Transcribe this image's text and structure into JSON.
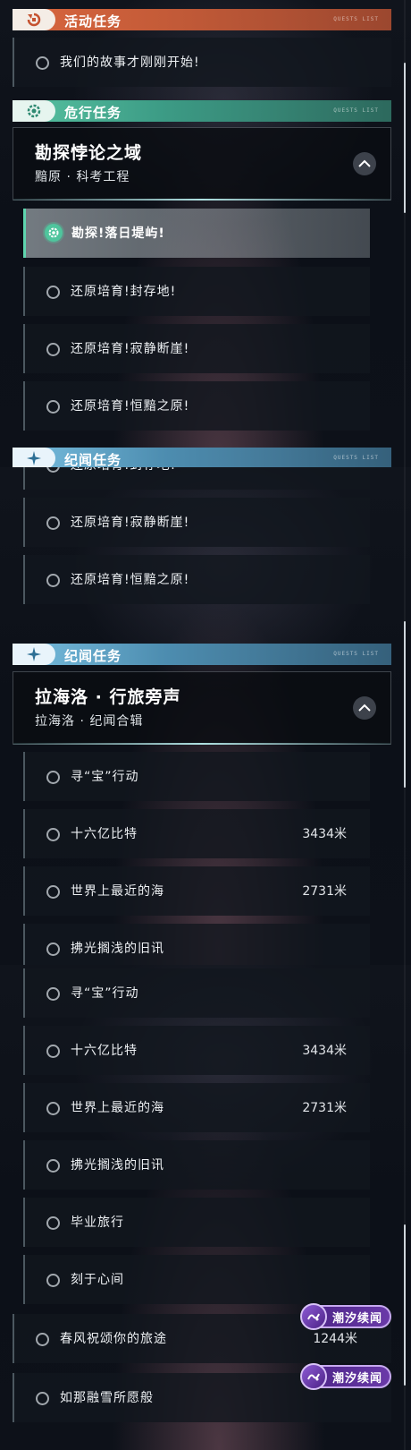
{
  "sections": {
    "active": "活动任务",
    "danger": "危行任务",
    "chronicle": "纪闻任务",
    "deco": "QUESTS LIST"
  },
  "active_quest": "我们的故事才刚刚开始!",
  "danger_card": {
    "title": "勘探悖论之域",
    "subtitle": "黯原 · 科考工程"
  },
  "danger_items": [
    "勘探!落日堤屿!",
    "还原培育!封存地!",
    "还原培育!寂静断崖!",
    "还原培育!恒黯之原!"
  ],
  "chronicle_card": {
    "title": "拉海洛 · 行旅旁声",
    "subtitle": "拉海洛 · 纪闻合辑"
  },
  "chronicle_items": [
    {
      "label": "寻“宝”行动",
      "distance": ""
    },
    {
      "label": "十六亿比特",
      "distance": "3434米"
    },
    {
      "label": "世界上最近的海",
      "distance": "2731米"
    },
    {
      "label": "拂光搁浅的旧讯",
      "distance": ""
    },
    {
      "label": "毕业旅行",
      "distance": ""
    },
    {
      "label": "刻于心间",
      "distance": ""
    }
  ],
  "tide_items": [
    {
      "label": "春风祝颂你的旅途",
      "distance": "1244米"
    },
    {
      "label": "如那融雪所愿般",
      "distance": ""
    }
  ],
  "badge_text": "潮汐续闻",
  "colors": {
    "active": "#d8663e",
    "danger": "#58c3a2",
    "chronicle": "#79bfe0",
    "badge": "#6a3aa8",
    "selected": "#4fc59d"
  }
}
